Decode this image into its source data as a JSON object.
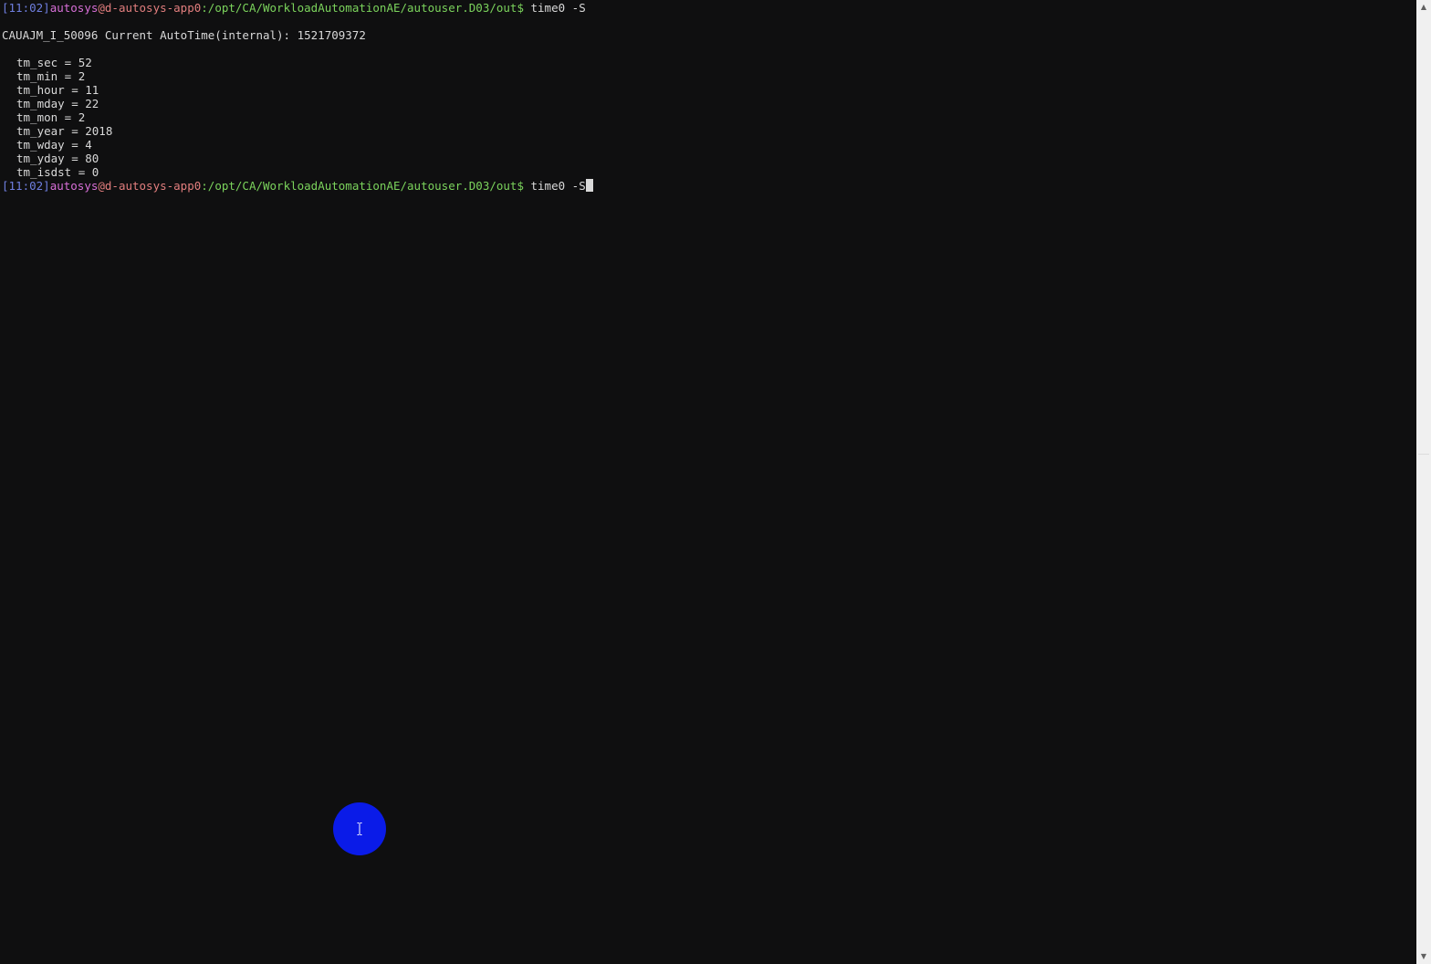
{
  "prompt": {
    "time": "[11:02]",
    "user": "autosys",
    "host": "@d-autosys-app0",
    "path": ":/opt/CA/WorkloadAutomationAE/autouser.D03/out$",
    "command": " time0 -S"
  },
  "output": {
    "message": "CAUAJM_I_50096 Current AutoTime(internal): 1521709372",
    "fields": [
      "tm_sec = 52",
      "tm_min = 2",
      "tm_hour = 11",
      "tm_mday = 22",
      "tm_mon = 2",
      "tm_year = 2018",
      "tm_wday = 4",
      "tm_yday = 80",
      "tm_isdst = 0"
    ]
  },
  "current_prompt": {
    "time": "[11:02]",
    "user": "autosys",
    "host": "@d-autosys-app0",
    "path": ":/opt/CA/WorkloadAutomationAE/autouser.D03/out$",
    "input": " time0 -S"
  },
  "colors": {
    "background": "#0f0f10",
    "time": "#6f7fe0",
    "user": "#d86fd8",
    "host": "#e27e7e",
    "path": "#7bd35c",
    "click_indicator": "#0a1be8"
  },
  "icons": {
    "cursor": "ibeam-cursor-icon"
  }
}
